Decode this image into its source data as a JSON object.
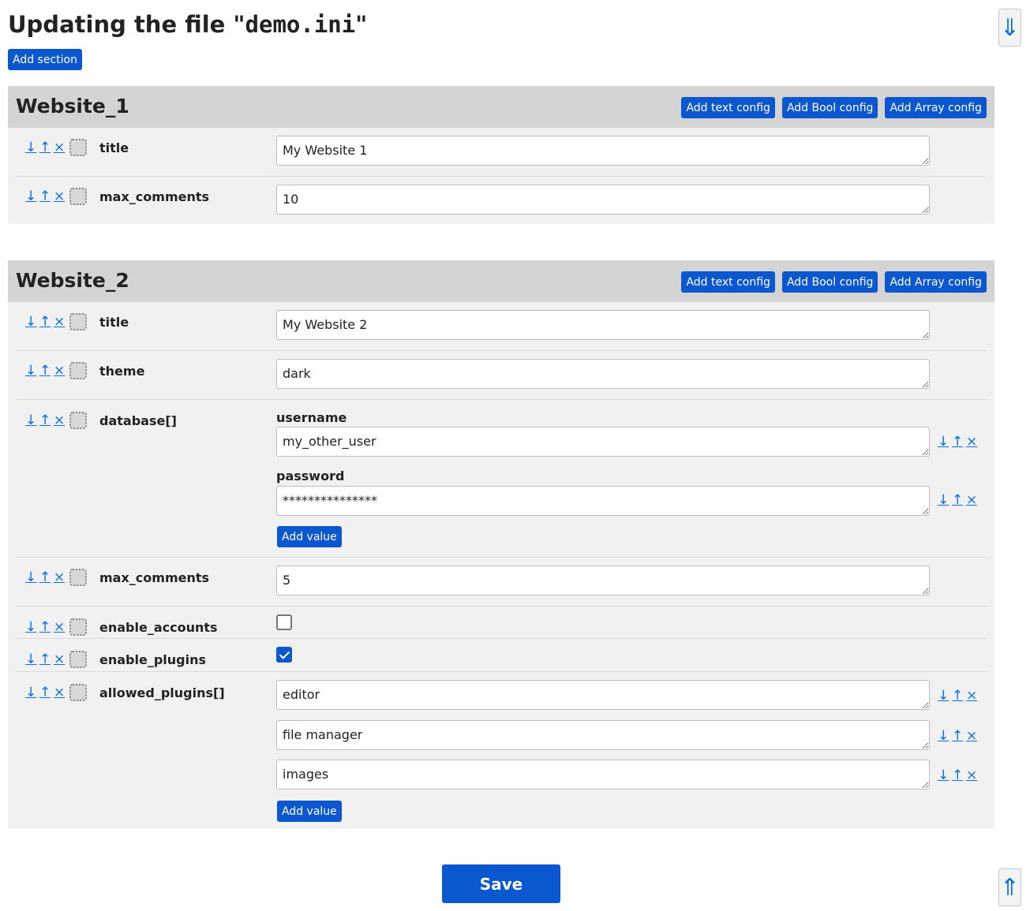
{
  "header": {
    "title_prefix": "Updating the file \"",
    "filename": "demo.ini",
    "title_suffix": "\"",
    "add_section_label": "Add section",
    "scroll_down_glyph": "⇓",
    "scroll_up_glyph": "⇑"
  },
  "controls": {
    "move_down": "↓",
    "move_up": "↑",
    "remove": "×"
  },
  "section_actions": {
    "add_text": "Add text config",
    "add_bool": "Add Bool config",
    "add_array": "Add Array config"
  },
  "sections": [
    {
      "name": "Website_1",
      "configs": [
        {
          "key": "title",
          "type": "text",
          "value": "My Website 1"
        },
        {
          "key": "max_comments",
          "type": "text",
          "value": "10"
        }
      ]
    },
    {
      "name": "Website_2",
      "configs": [
        {
          "key": "title",
          "type": "text",
          "value": "My Website 2"
        },
        {
          "key": "theme",
          "type": "text",
          "value": "dark"
        },
        {
          "key": "database[]",
          "type": "array",
          "values": [
            {
              "label": "username",
              "value": "my_other_user"
            },
            {
              "label": "password",
              "value": "***************"
            }
          ]
        },
        {
          "key": "max_comments",
          "type": "text",
          "value": "5"
        },
        {
          "key": "enable_accounts",
          "type": "bool",
          "checked": false
        },
        {
          "key": "enable_plugins",
          "type": "bool",
          "checked": true
        },
        {
          "key": "allowed_plugins[]",
          "type": "array",
          "values": [
            {
              "value": "editor"
            },
            {
              "value": "file manager"
            },
            {
              "value": "images"
            }
          ]
        }
      ]
    }
  ],
  "add_value_label": "Add value",
  "save_label": "Save"
}
